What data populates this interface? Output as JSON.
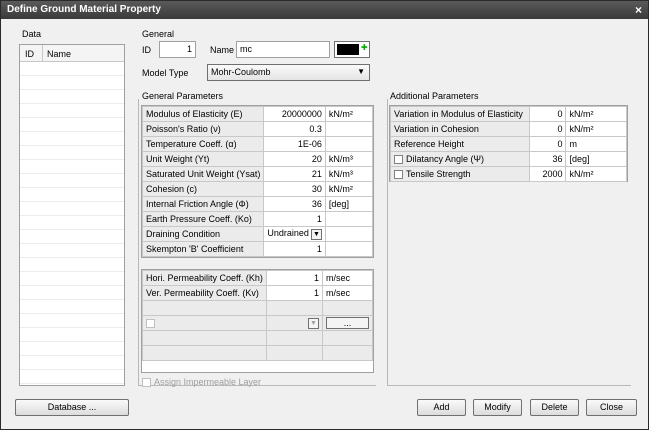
{
  "window": {
    "title": "Define Ground Material Property"
  },
  "data_list": {
    "label": "Data",
    "col_id": "ID",
    "col_name": "Name"
  },
  "general": {
    "label": "General",
    "id_label": "ID",
    "id_value": "1",
    "name_label": "Name",
    "name_value": "mc",
    "model_type_label": "Model Type",
    "model_type_value": "Mohr-Coulomb",
    "color": "#000000"
  },
  "general_params": {
    "label": "General Parameters",
    "rows": [
      {
        "name": "Modulus of Elasticity (E)",
        "value": "20000000",
        "unit": "kN/m²"
      },
      {
        "name": "Poisson's Ratio (ν)",
        "value": "0.3",
        "unit": ""
      },
      {
        "name": "Temperature Coeff. (α)",
        "value": "1E-06",
        "unit": ""
      },
      {
        "name": "Unit Weight (Yt)",
        "value": "20",
        "unit": "kN/m³"
      },
      {
        "name": "Saturated Unit Weight (Ysat)",
        "value": "21",
        "unit": "kN/m³"
      },
      {
        "name": "Cohesion (c)",
        "value": "30",
        "unit": "kN/m²"
      },
      {
        "name": "Internal Friction Angle (Φ)",
        "value": "36",
        "unit": "[deg]"
      },
      {
        "name": "Earth Pressure Coeff. (Ko)",
        "value": "1",
        "unit": ""
      },
      {
        "name": "Draining Condition",
        "value": "Undrained",
        "unit": ""
      },
      {
        "name": "Skempton 'B' Coefficient",
        "value": "1",
        "unit": ""
      }
    ],
    "perm_rows": [
      {
        "name": "Hori. Permeability Coeff. (Kh)",
        "value": "1",
        "unit": "m/sec"
      },
      {
        "name": "Ver. Permeability Coeff. (Kv)",
        "value": "1",
        "unit": "m/sec"
      }
    ],
    "ellipsis": "...",
    "assign_impermeable": "Assign Impermeable Layer"
  },
  "additional_params": {
    "label": "Additional Parameters",
    "rows": [
      {
        "name": "Variation in Modulus of Elasticity",
        "value": "0",
        "unit": "kN/m²",
        "check": false
      },
      {
        "name": "Variation in Cohesion",
        "value": "0",
        "unit": "kN/m²",
        "check": false
      },
      {
        "name": "Reference Height",
        "value": "0",
        "unit": "m",
        "check": false
      },
      {
        "name": "Dilatancy Angle (Ψ)",
        "value": "36",
        "unit": "[deg]",
        "check": true
      },
      {
        "name": "Tensile Strength",
        "value": "2000",
        "unit": "kN/m²",
        "check": true
      }
    ]
  },
  "buttons": {
    "database": "Database ...",
    "add": "Add",
    "modify": "Modify",
    "delete": "Delete",
    "close": "Close"
  }
}
